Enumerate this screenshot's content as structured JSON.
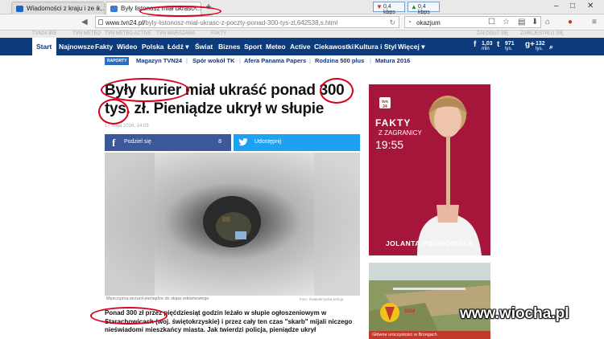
{
  "browser": {
    "tabs": [
      {
        "title": "Wiadomości z kraju i ze ś..."
      },
      {
        "title": "Były listonosz miał ukraść ..."
      }
    ],
    "new_tab": "+",
    "speed_down": "0,4 kbps",
    "speed_up": "0,4 kbps",
    "url_host": "www.tvn24.pl/",
    "url_path": "byly-listonosz-mial-ukrasc-z-poczty-ponad-300-tys-zl,642538,s.html",
    "search_text": "okazjum"
  },
  "site": {
    "subbar": [
      "TVN24 BIS",
      "TVN METEO",
      "TVN METEO ACTIVE",
      "TVN WARSZAWA",
      "FAKTY",
      "ZALOGUJ SIĘ",
      "ZAREJESTRUJ SIĘ"
    ],
    "nav": {
      "start": "Start",
      "items": [
        "Najnowsze",
        "Fakty",
        "Wideo",
        "Polska",
        "Łódź ▾",
        "Świat",
        "Biznes",
        "Sport",
        "Meteo",
        "Active",
        "Ciekawostki",
        "Kultura i Styl",
        "Więcej ▾"
      ]
    },
    "social": [
      {
        "icon": "f",
        "count": "1,03",
        "label": "mln"
      },
      {
        "icon": "t",
        "count": "971",
        "label": "tys."
      },
      {
        "icon": "g+",
        "count": "132",
        "label": "tys."
      }
    ],
    "trending": {
      "badge": "RAPORTY",
      "items": [
        "Magazyn TVN24",
        "Spór wokół TK",
        "Afera Panama Papers",
        "Rodzina 500 plus",
        "Matura 2016"
      ],
      "sep": "|"
    }
  },
  "article": {
    "headline_line1": "Były kurier miał ukraść ponad 300",
    "headline_line2": "tys. zł. Pieniądze ukrył w słupie",
    "date": "17 maja 2016,   14:03",
    "share_fb_label": "Podziel się",
    "share_fb_count": "8",
    "share_tw_label": "Udostępnij",
    "photo_caption": "Mężczyzna wrzucił pieniądze do słupa reklamowego",
    "photo_credit": "Foto: Świętokrzyska policja",
    "lead_bold": "Ponad 300 zł przez pięćdziesiąt godzin leżało w słupie ogłoszeniowym w Starachowicach (woj. świętokrzyskie) i przez cały ten czas \"skarb\" mijali niczego nieświadomi mieszkańcy miasta. Jak twierdzi policja, pieniądze ukrył"
  },
  "ads": {
    "ad1": {
      "logo": "tvn 24 bis",
      "brand": "FAKTY",
      "sub": "Z ZAGRANICY",
      "time": "19:55",
      "name": "JOLANTA PIEŃKOWSKA"
    },
    "ad2": {
      "caption": "Główne uroczystości w Brzegach",
      "logo_text": "SDM"
    }
  },
  "watermark": "www.wiocha.pl",
  "colors": {
    "nav_bg": "#0d3a7a",
    "fb": "#3b5998",
    "tw": "#1da1f2",
    "ad_red": "#a6153a",
    "annotation": "#d9001b"
  }
}
